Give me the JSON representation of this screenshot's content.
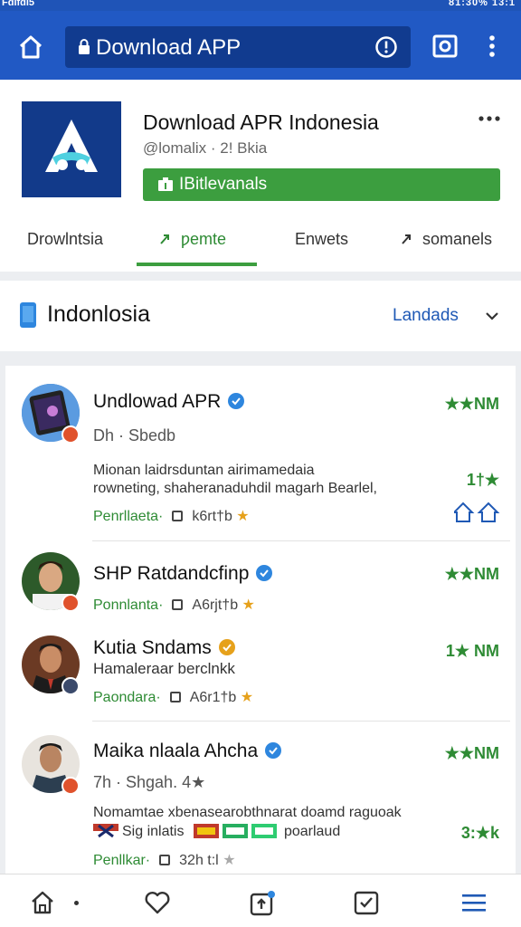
{
  "status_bar": {
    "left_text": "Fdlfdl5",
    "right_text": "81:30% 13:1"
  },
  "browser": {
    "url_text": "Download APP",
    "icons": [
      "home-icon",
      "lock-icon",
      "info-icon",
      "screenshot-icon",
      "more-vert-icon"
    ]
  },
  "app": {
    "name": "Download APR Indonesia",
    "subtitle": "@lomalix · 2! Bkia",
    "install_label": "IBitlevanals",
    "tabs": [
      {
        "label": "Drowlntsia"
      },
      {
        "label": "ƿemte"
      },
      {
        "label": "Enwets"
      },
      {
        "label": "somanels"
      }
    ]
  },
  "section": {
    "title": "Indonlosia",
    "sort_label": "Landads"
  },
  "list": [
    {
      "name": "Undlowad APR",
      "verified_color": "#2e86de",
      "rating": "★★NM",
      "meta": "Dh · Sbedb",
      "desc_line1": "Mionan laidrsduntan airimamedaia",
      "desc_line2": "rowneting, shaheranaduhdil magarh Bearlel,",
      "right_value": "1†★",
      "foot_label": "Penrllaeta·",
      "foot_value": "k6rt†b"
    },
    {
      "name": "SHP  Ratdandcfinp",
      "verified_color": "#2e86de",
      "rating": "★★NM",
      "foot_label": "Ponnlanta·",
      "foot_value": "A6rjt†b"
    },
    {
      "name": "Kutia Sndams",
      "verified_color": "#e6a11b",
      "rating": "1★ NM",
      "meta": "Hamaleraar berclnkk",
      "foot_label": "Paondara·",
      "foot_value": "A6r1†b"
    },
    {
      "name": "Maika nlaala Ahcha",
      "verified_color": "#2e86de",
      "rating": "★★NM",
      "meta": "7h · Shgah. 4★",
      "desc_line1": "Nomamtae xbenasearobthnarat doamd raguoak",
      "desc_line2": "Sig inlatis",
      "desc_line2b": "poarlaud",
      "right_value": "3:★k",
      "foot_label": "Penllkar·",
      "foot_value": "32h t:l"
    }
  ],
  "bottom_nav": {
    "items": [
      "home-icon",
      "heart-icon",
      "upload-icon",
      "check-icon",
      "menu-icon"
    ]
  },
  "colors": {
    "brand_blue": "#2159c4",
    "accent_green": "#3c9e3f",
    "link_blue": "#1f59b5"
  }
}
